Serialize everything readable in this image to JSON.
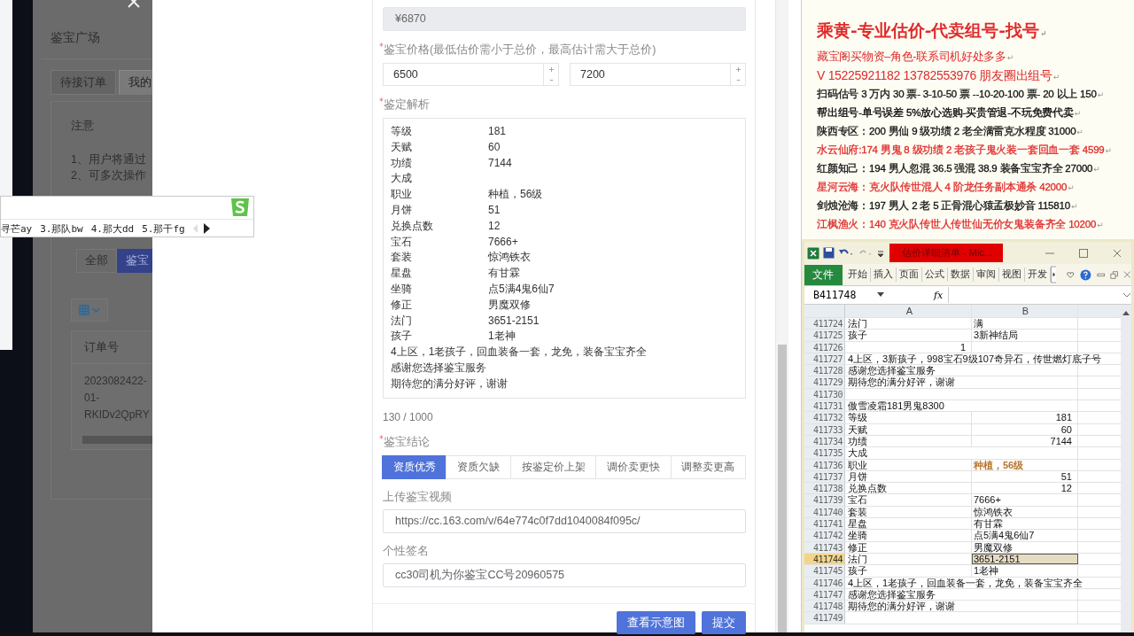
{
  "left_panel": {
    "title": "鉴宝广场",
    "tabs": [
      {
        "label": "待接订单",
        "selected": false
      },
      {
        "label": "我的",
        "selected": true
      }
    ],
    "notice": {
      "title": "注意",
      "lines": [
        "1、用户将通过",
        "2、可多次操作"
      ]
    },
    "filters": [
      {
        "label": "全部",
        "selected": false
      },
      {
        "label": "鉴宝",
        "selected": true
      }
    ],
    "table": {
      "columns": [
        "订单号"
      ],
      "rows": [
        [
          "2023082422-",
          "01-",
          "RKIDv2QpRY"
        ]
      ]
    }
  },
  "ime": {
    "candidates": [
      "寻芒ay",
      "3.那队bw",
      "4.那大dd",
      "5.那干fg"
    ]
  },
  "form": {
    "total": {
      "value": "¥6870",
      "disabled": true
    },
    "price": {
      "label": "鉴宝价格(最低估价需小于总价，最高估计需大于总价)",
      "required": true,
      "min": "6500",
      "max": "7200"
    },
    "analysis": {
      "label": "鉴定解析",
      "required": true,
      "counter": "130 / 1000",
      "lines": [
        {
          "kind": "pair",
          "key": "等级",
          "value": "181"
        },
        {
          "kind": "pair",
          "key": "天赋",
          "value": "60"
        },
        {
          "kind": "pair",
          "key": "功绩",
          "value": "7144"
        },
        {
          "kind": "pair",
          "key": "大成"
        },
        {
          "kind": "pair",
          "key": "职业",
          "value": "种植，56级"
        },
        {
          "kind": "pair",
          "key": "月饼",
          "value": "51"
        },
        {
          "kind": "pair",
          "key": "兑换点数",
          "value": "12"
        },
        {
          "kind": "pair",
          "key": "宝石",
          "value": "7666+"
        },
        {
          "kind": "pair",
          "key": "套装",
          "value": "惊鸿铁衣"
        },
        {
          "kind": "pair",
          "key": "星盘",
          "value": "有甘霖"
        },
        {
          "kind": "pair",
          "key": "坐骑",
          "value": "点5满4鬼6仙7"
        },
        {
          "kind": "pair",
          "key": "修正",
          "value": "男魔双修"
        },
        {
          "kind": "pair",
          "key": "法门",
          "value": "3651-2151"
        },
        {
          "kind": "pair",
          "key": "孩子",
          "value": "1老神"
        },
        {
          "kind": "text",
          "text": "4上区，1老孩子，回血装备一套，龙免，装备宝宝齐全"
        },
        {
          "kind": "text",
          "text": "感谢您选择鉴宝服务"
        },
        {
          "kind": "text",
          "text": "期待您的满分好评，谢谢"
        }
      ]
    },
    "conclusion": {
      "label": "鉴宝结论",
      "required": true,
      "options": [
        {
          "label": "资质优秀",
          "selected": true
        },
        {
          "label": "资质欠缺",
          "selected": false
        },
        {
          "label": "按鉴定价上架",
          "selected": false
        },
        {
          "label": "调价卖更快",
          "selected": false
        },
        {
          "label": "调整卖更高",
          "selected": false
        }
      ]
    },
    "video": {
      "label": "上传鉴宝视频",
      "value": "https://cc.163.com/v/64e774c0f7dd1040084f095c/"
    },
    "signature": {
      "label": "个性签名",
      "value": "cc30司机为你鉴宝CC号20960575"
    },
    "buttons": [
      "查看示意图",
      "提交"
    ]
  },
  "document": {
    "heading": "乘黄-专业估价-代卖组号-找号",
    "end_mark": "↵",
    "lines": [
      {
        "text": "藏宝阁买物资–角色-联系司机好处多多",
        "color": "#e02a2a",
        "kind": "medium"
      },
      {
        "text": "V 15225921182   13782553976 朋友圈出组号",
        "color": "#e02a2a",
        "kind": "large"
      },
      {
        "text": "扫码估号 3 万内 30 票- 3-10-50 票  --10-20-100 票- 20 以上 150",
        "color": "#111111",
        "kind": "normal"
      },
      {
        "text": "帮出组号-单号误差 5%放心选购-买贵管退-不玩免费代卖",
        "color": "#000000",
        "kind": "normal"
      },
      {
        "text": "陕西专区：200 男仙 9 级功绩 2 老全满雷克水程度 31000",
        "color": "#111111",
        "kind": "normal"
      },
      {
        "text": "水云仙府:174 男鬼 8 级功绩 2 老孩子鬼火装一套回血一套 4599",
        "color": "#e02a2a",
        "kind": "normal"
      },
      {
        "text": "红颜知己：194 男人忽混 36.5 强混 38.9 装备宝宝齐全 27000",
        "color": "#111111",
        "kind": "normal"
      },
      {
        "text": "星河云海：克火队传世混人 4 阶龙任务副本通杀 42000",
        "color": "#e02a2a",
        "kind": "normal"
      },
      {
        "text": "剑烛沧海：197 男人 2 老 5 正骨混心猿孟极妙音 115810",
        "color": "#111111",
        "kind": "normal"
      },
      {
        "text": "江枫渔火：140 克火队传世人传世仙无价女鬼装备齐全 10200",
        "color": "#e02a2a",
        "kind": "normal"
      }
    ]
  },
  "excel": {
    "title": "估价详细清单 - Mic...",
    "file_tab": "文件",
    "ribbon_tabs": [
      "开始",
      "插入",
      "页面",
      "公式",
      "数据",
      "审阅",
      "视图",
      "开发"
    ],
    "name_box": "B411748",
    "fx_label": "fx",
    "columns": [
      "A",
      "B"
    ],
    "rows": [
      {
        "num": "411724",
        "a": "法门",
        "b": "满",
        "selected": false
      },
      {
        "num": "411725",
        "a": "孩子",
        "b": "3新神结局",
        "selected": false
      },
      {
        "num": "411726",
        "a": "1",
        "a_number": true,
        "b": "",
        "selected": false
      },
      {
        "num": "411727",
        "a": "4上区，3新孩子，998宝石9级107奇异石，传世燃灯底子号",
        "selected": false
      },
      {
        "num": "411728",
        "a": "感谢您选择鉴宝服务",
        "selected": false
      },
      {
        "num": "411729",
        "a": "期待您的满分好评，谢谢",
        "selected": false
      },
      {
        "num": "411730",
        "selected": false
      },
      {
        "num": "411731",
        "a": "傲雪凌霜181男鬼8300",
        "selected": false
      },
      {
        "num": "411732",
        "a": "等级",
        "b": "181",
        "b_number": true,
        "selected": false
      },
      {
        "num": "411733",
        "a": "天赋",
        "b": "60",
        "b_number": true,
        "selected": false
      },
      {
        "num": "411734",
        "a": "功绩",
        "b": "7144",
        "b_number": true,
        "selected": false
      },
      {
        "num": "411735",
        "a": "大成",
        "selected": false
      },
      {
        "num": "411736",
        "a": "职业",
        "b": "种植，56级",
        "b_emphasis": true,
        "selected": false
      },
      {
        "num": "411737",
        "a": "月饼",
        "b": "51",
        "b_number": true,
        "selected": false
      },
      {
        "num": "411738",
        "a": "兑换点数",
        "b": "12",
        "b_number": true,
        "selected": false
      },
      {
        "num": "411739",
        "a": "宝石",
        "b": "7666+",
        "selected": false
      },
      {
        "num": "411740",
        "a": "套装",
        "b": "惊鸿铁衣",
        "selected": false
      },
      {
        "num": "411741",
        "a": "星盘",
        "b": "有甘霖",
        "selected": false
      },
      {
        "num": "411742",
        "a": "坐骑",
        "b": "点5满4鬼6仙7",
        "selected": false
      },
      {
        "num": "411743",
        "a": "修正",
        "b": "男魔双修",
        "selected": false
      },
      {
        "num": "411744",
        "a": "法门",
        "b": "3651-2151",
        "selected": true
      },
      {
        "num": "411745",
        "a": "孩子",
        "b": "1老神",
        "selected": false
      },
      {
        "num": "411746",
        "a": "4上区，1老孩子，回血装备一套，龙免，装备宝宝齐全",
        "selected": false
      },
      {
        "num": "411747",
        "a": "感谢您选择鉴宝服务",
        "selected": false
      },
      {
        "num": "411748",
        "a": "期待您的满分好评，谢谢",
        "selected": false
      },
      {
        "num": "411749",
        "selected": false
      }
    ]
  }
}
